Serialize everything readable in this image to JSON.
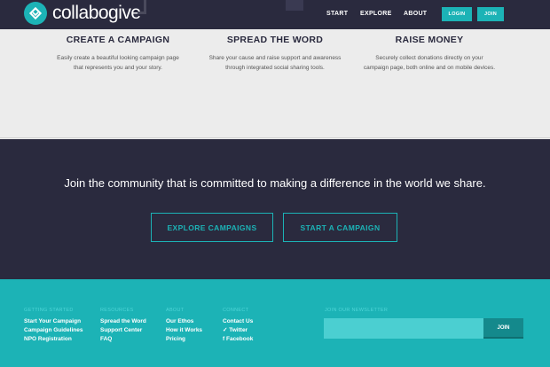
{
  "header": {
    "logo_text": "collabogive",
    "nav": [
      "START",
      "EXPLORE",
      "ABOUT"
    ],
    "login_label": "LOGIN",
    "join_label": "JOIN"
  },
  "features": [
    {
      "title": "CREATE A CAMPAIGN",
      "desc": "Easily create a beautiful looking campaign page that represents you and your story."
    },
    {
      "title": "SPREAD THE WORD",
      "desc": "Share your cause and raise support and awareness through integrated social sharing tools."
    },
    {
      "title": "RAISE MONEY",
      "desc": "Securely collect donations directly on your campaign page, both online and on mobile devices."
    }
  ],
  "community": {
    "text": "Join the community that is committed to making a difference in the world we share.",
    "explore_label": "EXPLORE CAMPAIGNS",
    "start_label": "START A CAMPAIGN"
  },
  "footer": {
    "columns": [
      {
        "heading": "GETTING STARTED",
        "links": [
          "Start Your Campaign",
          "Campaign Guidelines",
          "NPO Registration"
        ]
      },
      {
        "heading": "RESOURCES",
        "links": [
          "Spread the Word",
          "Support Center",
          "FAQ"
        ]
      },
      {
        "heading": "ABOUT",
        "links": [
          "Our Ethos",
          "How it Works",
          "Pricing"
        ]
      },
      {
        "heading": "CONNECT",
        "links": [
          "Contact Us",
          "Twitter",
          "Facebook"
        ]
      }
    ],
    "newsletter": {
      "heading": "JOIN OUR NEWSLETTER",
      "placeholder": "",
      "button_label": "JOIN"
    }
  },
  "colors": {
    "brand_teal": "#1cb3b6",
    "dark_navy": "#2a2a3e"
  },
  "icons": [
    "logo-heart-icon",
    "twitter-icon",
    "facebook-icon"
  ]
}
